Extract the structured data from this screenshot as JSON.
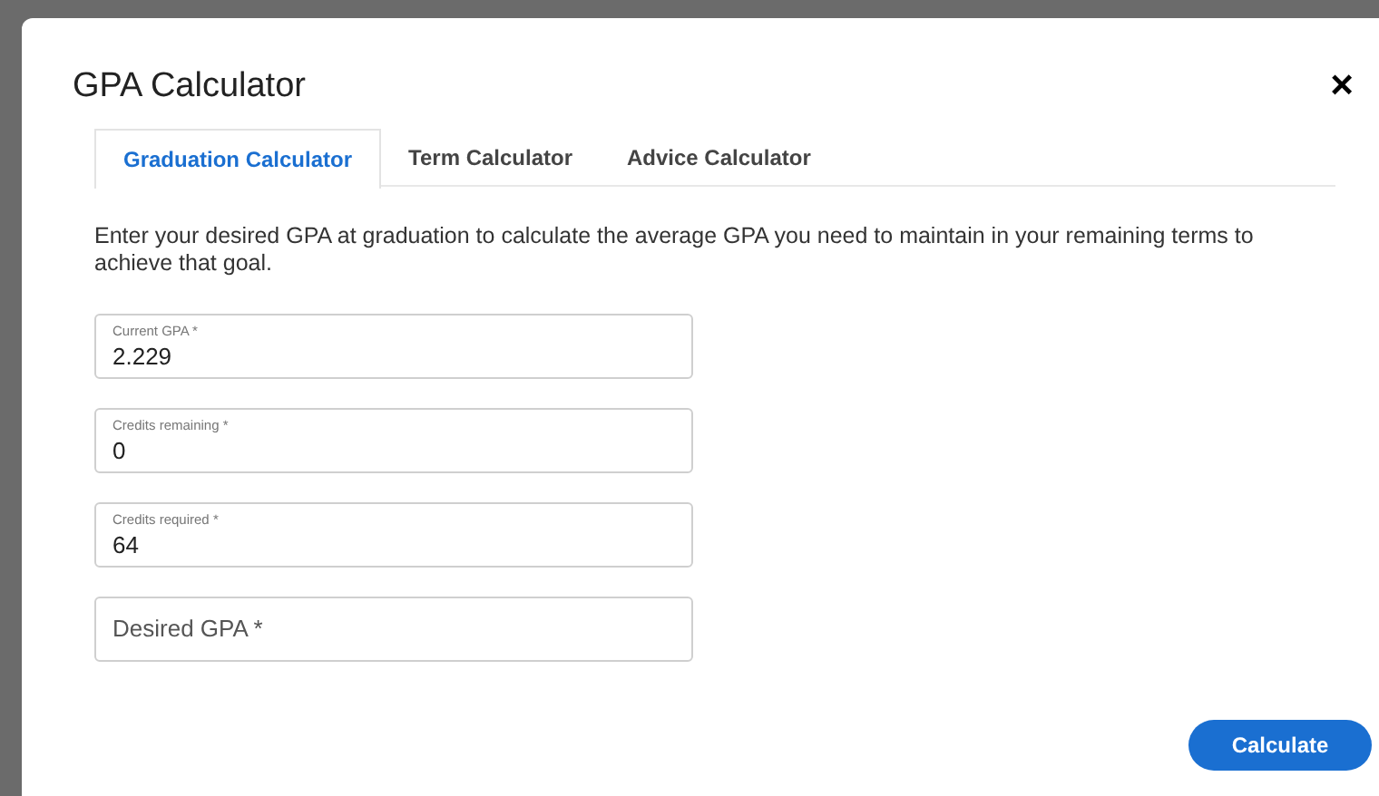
{
  "dialog": {
    "title": "GPA Calculator",
    "close": "×"
  },
  "tabs": [
    {
      "label": "Graduation Calculator",
      "selected": true
    },
    {
      "label": "Term Calculator",
      "selected": false
    },
    {
      "label": "Advice Calculator",
      "selected": false
    }
  ],
  "description": "Enter your desired GPA at graduation to calculate the average GPA you need to maintain in your remaining terms to achieve that goal.",
  "fields": [
    {
      "label": "Current GPA *",
      "value": "2.229"
    },
    {
      "label": "Credits remaining *",
      "value": "0"
    },
    {
      "label": "Credits required *",
      "value": "64"
    },
    {
      "placeholder": "Desired GPA *"
    }
  ],
  "button": "Calculate"
}
